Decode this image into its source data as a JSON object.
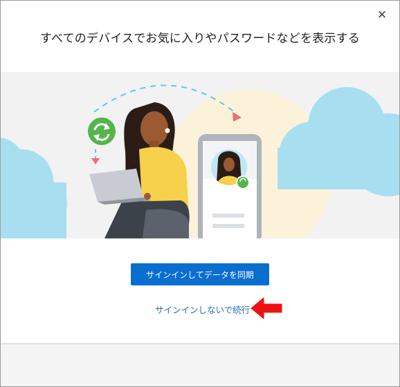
{
  "dialog": {
    "title": "すべてのデバイスでお気に入りやパスワードなどを表示する",
    "close_glyph": "✕",
    "primary_button_label": "サインインしてデータを同期",
    "secondary_link_label": "サインインしないで続行"
  },
  "colors": {
    "primary_button": "#0a6ed1",
    "link": "#1f6fc2",
    "annotation_arrow": "#ee1111",
    "cloud": "#a7dff0",
    "sun": "#fcf2d9",
    "sync_badge": "#55b44b"
  },
  "icons": [
    "close-icon",
    "sync-icon",
    "red-arrow-annotation"
  ]
}
